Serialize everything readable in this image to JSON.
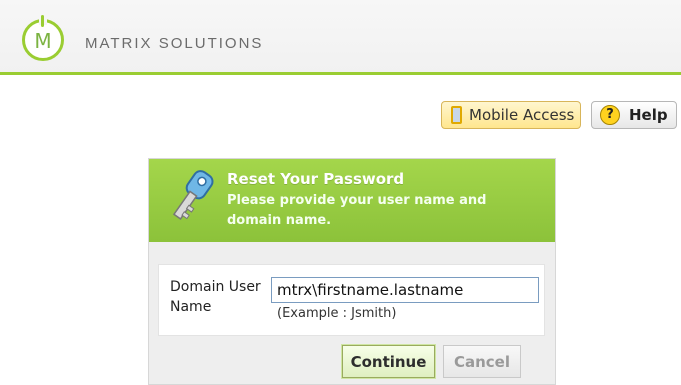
{
  "brand": {
    "logo_letter": "M",
    "name": "MATRIX SOLUTIONS",
    "accent_color": "#9acd32"
  },
  "toolbar": {
    "mobile_label": "Mobile Access",
    "mobile_icon": "mobile-phone-icon",
    "help_label": "Help",
    "help_icon": "question-mark-icon",
    "help_glyph": "?"
  },
  "panel": {
    "title": "Reset Your Password",
    "subtitle": "Please provide your user name and domain name.",
    "icon": "key-icon"
  },
  "form": {
    "label": "Domain User Name",
    "value": "mtrx\\firstname.lastname",
    "example": "(Example : Jsmith)"
  },
  "actions": {
    "continue_label": "Continue",
    "cancel_label": "Cancel"
  }
}
